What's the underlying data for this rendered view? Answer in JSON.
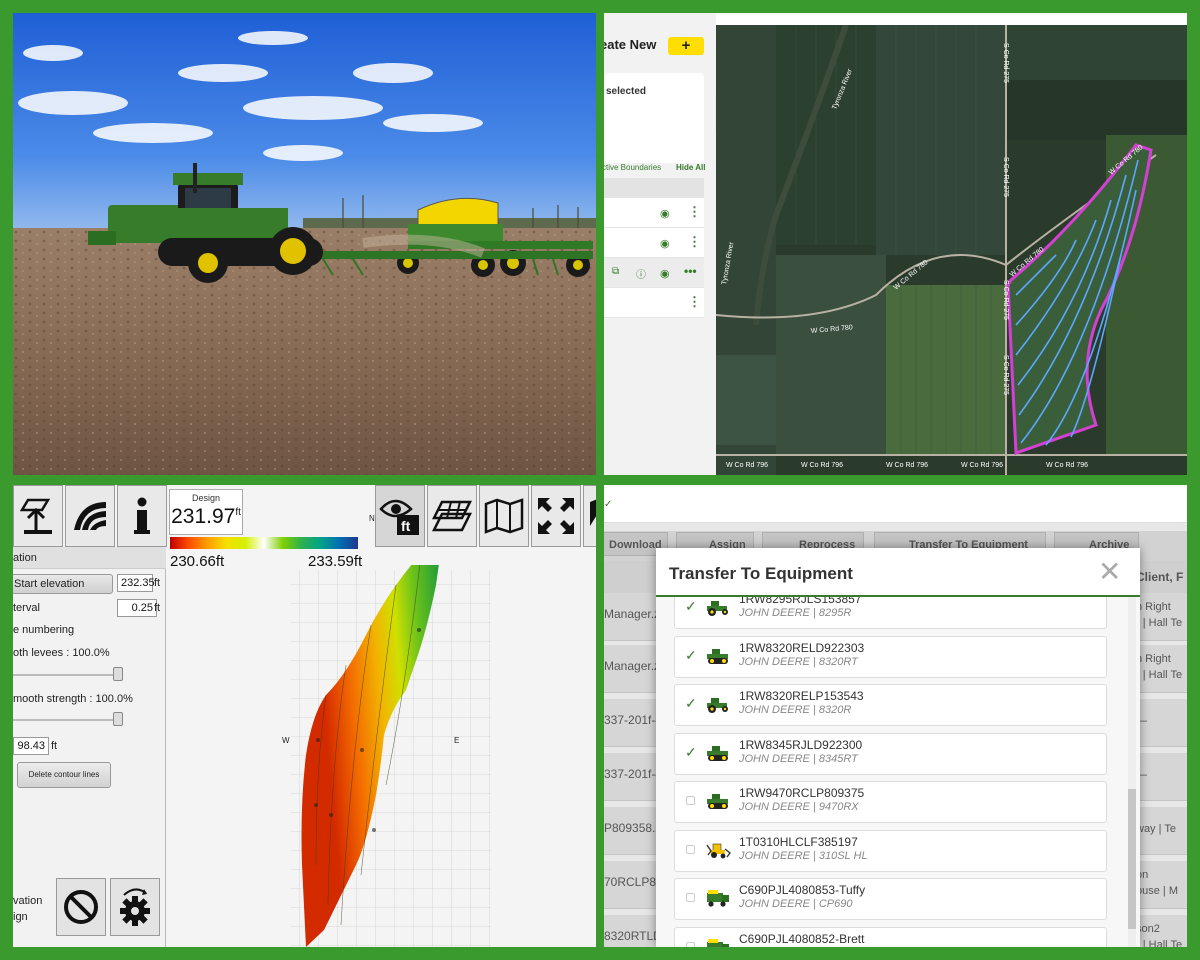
{
  "colors": {
    "frame": "#3a9a2e",
    "jd_green": "#367c2b",
    "jd_yellow": "#ffde00",
    "boundary": "#d43fd4",
    "guidance": "#5aa8ff"
  },
  "map_panel": {
    "create_new": "eate New",
    "plus": "+",
    "selected": "selected",
    "active_boundaries": "ctive Boundaries",
    "hide_all": "Hide All",
    "toggle_icon": "list-icon",
    "labels": {
      "river1": "Tyronza River",
      "river2": "Tyronza River",
      "rd275a": "S Co Rd 275",
      "rd275b": "S Co Rd 275",
      "rd275c": "S Co Rd 275",
      "rd275d": "S Co Rd 275",
      "rd780a": "W Co Rd 780",
      "rd780b": "W Co Rd 780",
      "rd780c": "W Co Rd 780",
      "rd780d": "W Co Rd 780",
      "rd796a": "W Co Rd 796",
      "rd796b": "W Co Rd 796",
      "rd796c": "W Co Rd 796",
      "rd796d": "W Co Rd 796",
      "rd796e": "W Co Rd 796",
      "rd780ne": "W Co Rd 780"
    }
  },
  "elevation_panel": {
    "design_label": "Design",
    "design_value": "231.97",
    "design_unit": "ft",
    "scale_min": "230.66ft",
    "scale_max": "233.59ft",
    "compass": {
      "n": "N",
      "w": "W",
      "e": "E"
    },
    "section_title": "ation",
    "start_elevation": "Start elevation",
    "start_elevation_value": "232.35",
    "interval_label": "terval",
    "interval_value": "0.25",
    "numbering": "e numbering",
    "smooth_levees": "oth levees  : 100.0%",
    "smooth_strength": "mooth strength  : 100.0%",
    "distance_value": "98.43",
    "unit_ft": "ft",
    "delete_contours": "Delete contour lines",
    "bottom_line1": "vation",
    "bottom_line2": "ign",
    "smooth_levees_level": 1.0,
    "smooth_strength_level": 1.0
  },
  "transfer_panel": {
    "actions": [
      "Download",
      "Assign",
      "Reprocess",
      "Transfer To Equipment",
      "Archive"
    ],
    "header_right": "Client, F",
    "bg_rows": [
      {
        "left": "Manager.zi",
        "right1": "n Right",
        "right2": "r | Hall Te"
      },
      {
        "left": "Manager.z",
        "right1": "n Right",
        "right2": "r | Hall Te"
      },
      {
        "left": "337-201f-4",
        "right1": "",
        "right2": "—"
      },
      {
        "left": "337-201f-4",
        "right1": "",
        "right2": "—"
      },
      {
        "left": "P809358.zi",
        "right1": "",
        "right2": "way | Te"
      },
      {
        "left": "70RCLP809",
        "right1": "on",
        "right2": "ouse | M"
      },
      {
        "left": "8320RTLDS",
        "right1": "son2",
        "right2": "r | Hall Te"
      }
    ],
    "modal_title": "Transfer To Equipment",
    "close_icon": "close-icon",
    "equipment": [
      {
        "serial": "1RW8295RJLS153857",
        "model": "JOHN DEERE | 8295R",
        "checked": true,
        "type": "tractor"
      },
      {
        "serial": "1RW8320RELD922303",
        "model": "JOHN DEERE | 8320RT",
        "checked": true,
        "type": "track"
      },
      {
        "serial": "1RW8320RELP153543",
        "model": "JOHN DEERE | 8320R",
        "checked": true,
        "type": "tractor"
      },
      {
        "serial": "1RW8345RJLD922300",
        "model": "JOHN DEERE | 8345RT",
        "checked": true,
        "type": "track"
      },
      {
        "serial": "1RW9470RCLP809375",
        "model": "JOHN DEERE | 9470RX",
        "checked": false,
        "type": "track"
      },
      {
        "serial": "1T0310HLCLF385197",
        "model": "JOHN DEERE | 310SL HL",
        "checked": false,
        "type": "backhoe"
      },
      {
        "serial": "C690PJL4080853-Tuffy",
        "model": "JOHN DEERE | CP690",
        "checked": false,
        "type": "picker"
      },
      {
        "serial": "C690PJL4080852-Brett",
        "model": "",
        "checked": false,
        "type": "picker"
      }
    ]
  }
}
